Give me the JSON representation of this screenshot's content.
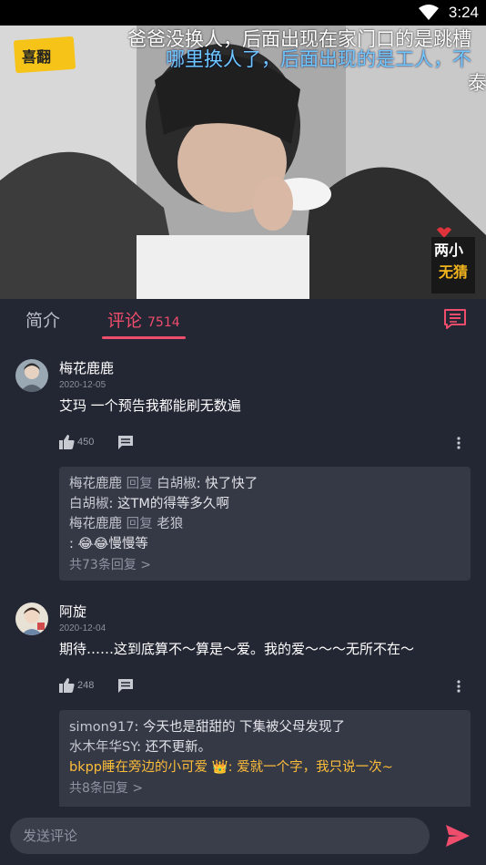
{
  "status": {
    "time": "3:24"
  },
  "video": {
    "danmu": [
      "爸爸没换人，后面出现在家门口的是跳槽",
      "哪里换人了，后面出现的是工人，不",
      "泰"
    ],
    "logo_text": "喜翻",
    "badge_text": "两小无猜"
  },
  "tabs": {
    "intro": "简介",
    "comments": "评论",
    "comments_count": "7514"
  },
  "comments": [
    {
      "user": "梅花鹿鹿",
      "date": "2020-12-05",
      "text": "艾玛 一个预告我都能刷无数遍",
      "likes": "450",
      "replies": [
        {
          "who": "梅花鹿鹿",
          "verb": "回复",
          "target": "白胡椒",
          "text": "快了快了"
        },
        {
          "who": "白胡椒",
          "text": "这TM的得等多久啊"
        },
        {
          "who": "梅花鹿鹿",
          "verb": "回复",
          "target": "老狼",
          "text": "😂😂慢慢等"
        }
      ],
      "more": "共73条回复 >"
    },
    {
      "user": "阿旋",
      "date": "2020-12-04",
      "text": "期待……这到底算不～算是～爱。我的爱～～～无所不在～",
      "likes": "248",
      "replies": [
        {
          "who": "simon917",
          "text": "今天也是甜甜的 下集被父母发现了"
        },
        {
          "who": "水木年华SY",
          "text": "还不更新。"
        },
        {
          "who": "bkpp睡在旁边的小可爱 👑",
          "text": "爱就一个字，我只说一次~"
        }
      ],
      "more": "共8条回复 >"
    }
  ],
  "input": {
    "placeholder": "发送评论"
  },
  "colors": {
    "accent": "#ef4d6c",
    "background": "#232633",
    "reply_bg": "#353946",
    "vip": "#ffbe3a"
  }
}
